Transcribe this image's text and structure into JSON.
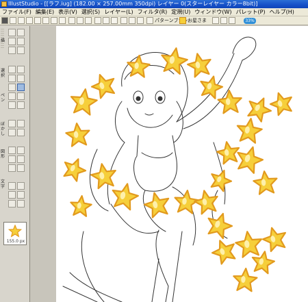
{
  "window": {
    "title": "IllustStudio - [[ラフ.iug] (182.00 × 257.00mm 350dpi)  レイヤー 0(スターレイヤー カラー8bit)]"
  },
  "menu": {
    "items": [
      "ファイル(F)",
      "編集(E)",
      "表示(V)",
      "選択(S)",
      "レイヤー(L)",
      "フィルタ(R)",
      "定規(U)",
      "ウィンドウ(W)",
      "パレット(P)",
      "ヘルプ(H)"
    ]
  },
  "toolbar": {
    "pattern_brush_label": "パターンブラシ",
    "star_brush_label": "お星さま",
    "zoom_badge": "33%"
  },
  "tool_palette": {
    "labels": [
      "描",
      "選択",
      "ペン",
      "ぼかし",
      "図形",
      "文字"
    ]
  },
  "brush_preset": {
    "size_label": "155.0 px"
  },
  "canvas": {
    "background": "#ffffff",
    "star_fill": "#f6cf3a",
    "star_stroke": "#e29a1e",
    "line_color": "#333333"
  }
}
